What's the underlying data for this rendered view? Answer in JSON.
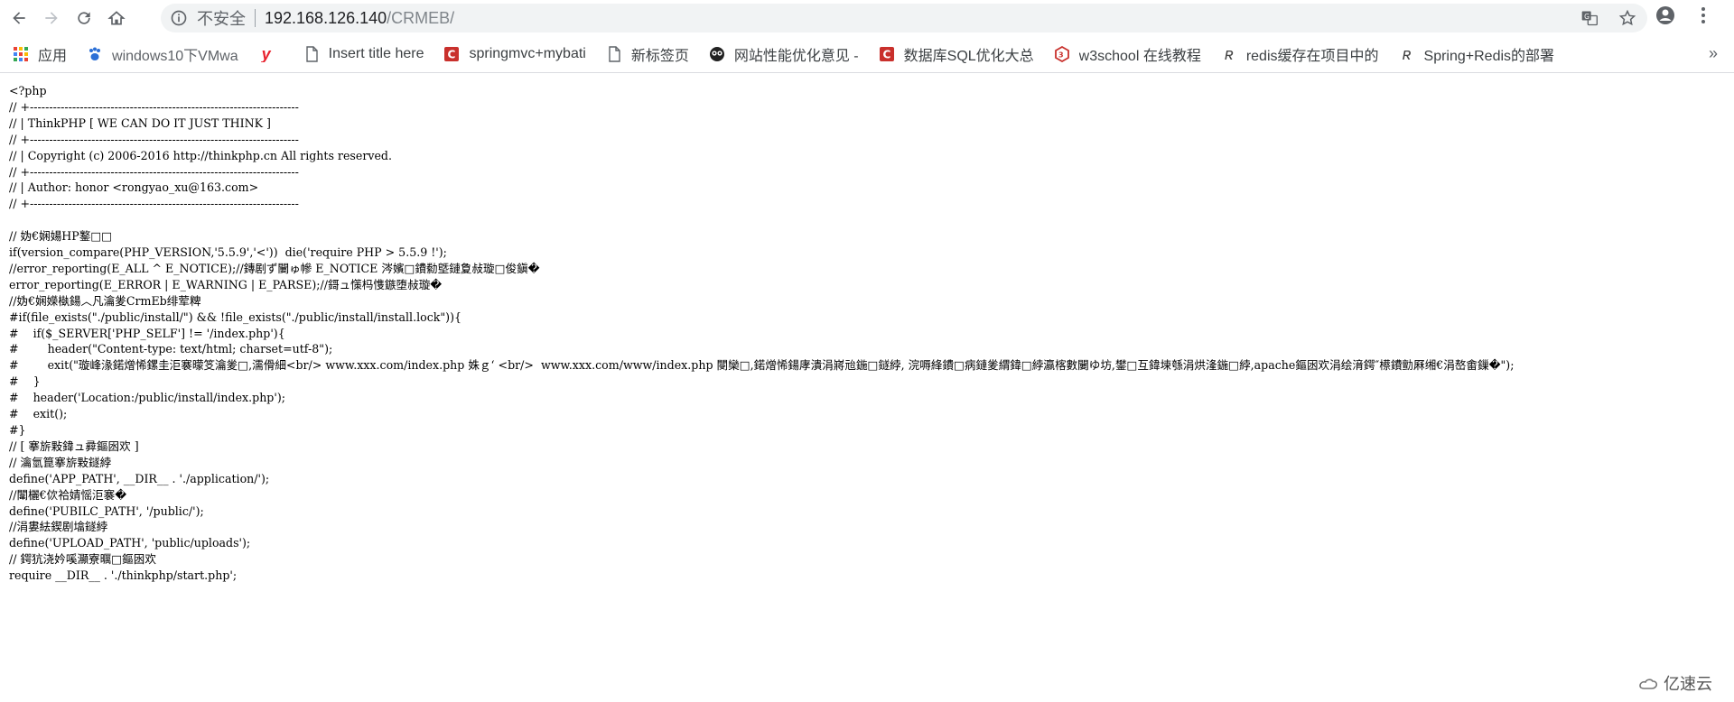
{
  "browser": {
    "insecure_label": "不安全",
    "url_host": "192.168.126.140",
    "url_path": "/CRMEB/",
    "bookmarks": [
      {
        "label": "应用",
        "icon": "apps-grid-icon"
      },
      {
        "label": "windows10下VMwa",
        "icon": "paw-icon"
      },
      {
        "label": "",
        "icon": "y-logo-icon"
      },
      {
        "label": "Insert title here",
        "icon": "page-icon"
      },
      {
        "label": "springmvc+mybati",
        "icon": "c-logo-icon"
      },
      {
        "label": "新标签页",
        "icon": "page-icon"
      },
      {
        "label": "网站性能优化意见 - ",
        "icon": "owl-icon"
      },
      {
        "label": "数据库SQL优化大总",
        "icon": "c-logo-icon"
      },
      {
        "label": "w3school 在线教程",
        "icon": "w3-logo-icon"
      },
      {
        "label": "redis缓存在项目中的",
        "icon": "r-logo-icon"
      },
      {
        "label": "Spring+Redis的部署",
        "icon": "r-logo-icon"
      }
    ],
    "more_label": "»"
  },
  "source_lines": [
    "<?php",
    "// +----------------------------------------------------------------------",
    "// | ThinkPHP [ WE CAN DO IT JUST THINK ]",
    "// +----------------------------------------------------------------------",
    "// | Copyright (c) 2006-2016 http://thinkphp.cn All rights reserved.",
    "// +----------------------------------------------------------------------",
    "// | Author: honor <rongyao_xu@163.com>",
    "// +----------------------------------------------------------------------",
    "",
    "// 妫€娴婸HP鐜□□",
    "if(version_compare(PHP_VERSION,'5.5.9','<'))  die('require PHP > 5.5.9 !');",
    "//error_reporting(E_ALL ^ E_NOTICE);//鏄剧ず闄ゅ幓 E_NOTICE 涔嬪□鐨勬墍鏈夐敊璇□俊鎭�",
    "error_reporting(E_ERROR | E_WARNING | E_PARSE);//鎶ュ憡杩愯鏃堕敊璇�",
    "//妫€娴嬫槸鍚︿凡瀹夎CrmEb绯荤粺",
    "#if(file_exists(\"./public/install/\") && !file_exists(\"./public/install/install.lock\")){",
    "#    if($_SERVER['PHP_SELF'] != '/index.php'){",
    "#        header(\"Content-type: text/html; charset=utf-8\");",
    "#        exit(\"璇峰湪鍩熷悕鏍圭洰褰曚笅瀹夎□,濡傦細<br/> www.xxx.com/index.php 姝ｇ‘ <br/>  www.xxx.com/www/index.php 閿欒□,鍩熷悕鍚庨潰涓嶈兘鍦□鐩綍, 浣嗕綘鐨□病鏈夎緭鍏□綍瀛楁數闄ゆ坊,鐢□互鍏堜綔涓烘湰鍦□綍,apache鏂囦欢涓绘湇鍔″櫒鐨勯厤缃€涓嶅畬鏁�\");",
    "#    }",
    "#    header('Location:/public/install/index.php');",
    "#    exit();",
    "#}",
    "// [ 搴旂敤鍏ュ彛鏂囦欢 ]",
    "// 瀹氫箟搴旂敤鐩綍",
    "define('APP_PATH', __DIR__ . './application/');",
    "//闈欐€佽祫婧愮洰褰�",
    "define('PUBILC_PATH', '/public/');",
    "//涓婁紶鍥剧墖鐩綍",
    "define('UPLOAD_PATH', 'public/uploads');",
    "// 鍔犺浇妗嗘灦寮曞□鏂囦欢",
    "require __DIR__ . './thinkphp/start.php';"
  ],
  "watermark": {
    "text": "亿速云"
  }
}
